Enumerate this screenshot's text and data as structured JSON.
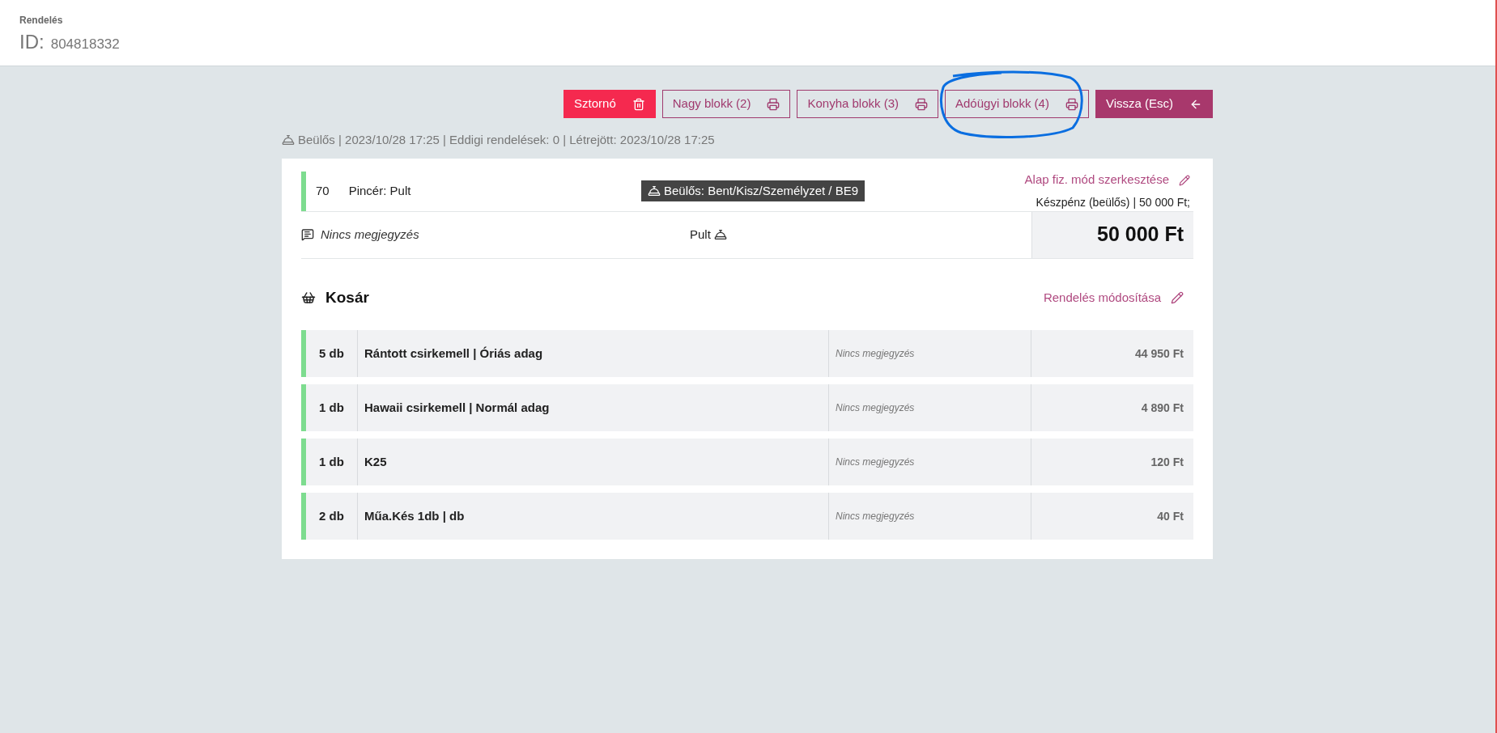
{
  "header": {
    "title": "Rendelés",
    "id_label": "ID:",
    "id_value": "804818332"
  },
  "actions": [
    {
      "label": "Sztornó",
      "kind": "danger",
      "circled": false
    },
    {
      "label": "Nagy blokk (2)",
      "kind": "print",
      "circled": false
    },
    {
      "label": "Konyha blokk (3)",
      "kind": "print",
      "circled": false
    },
    {
      "label": "Adóügyi blokk (4)",
      "kind": "print",
      "circled": true
    },
    {
      "label": "Vissza (Esc)",
      "kind": "back",
      "circled": false
    }
  ],
  "meta": "Beülős | 2023/10/28 17:25 | Eddigi rendelések: 0 | Létrejött: 2023/10/28 17:25",
  "order": {
    "table_number": "70",
    "waiter": "Pincér: Pult",
    "location": "Beülős: Bent/Kisz/Személyzet / BE9",
    "edit_link": "Alap fiz. mód szerkesztése",
    "payment": "Készpénz (beülős) | 50 000 Ft;",
    "note": "Nincs megjegyzés",
    "source": "Pult",
    "total": "50 000 Ft"
  },
  "cart": {
    "title": "Kosár",
    "edit_link": "Rendelés módosítása",
    "items": [
      {
        "qty": "5 db",
        "name": "Rántott csirkemell | Óriás adag",
        "note": "Nincs megjegyzés",
        "price": "44 950 Ft"
      },
      {
        "qty": "1 db",
        "name": "Hawaii csirkemell | Normál adag",
        "note": "Nincs megjegyzés",
        "price": "4 890 Ft"
      },
      {
        "qty": "1 db",
        "name": "K25",
        "note": "Nincs megjegyzés",
        "price": "120 Ft"
      },
      {
        "qty": "2 db",
        "name": "Műa.Kés 1db | db",
        "note": "Nincs megjegyzés",
        "price": "40 Ft"
      }
    ]
  }
}
